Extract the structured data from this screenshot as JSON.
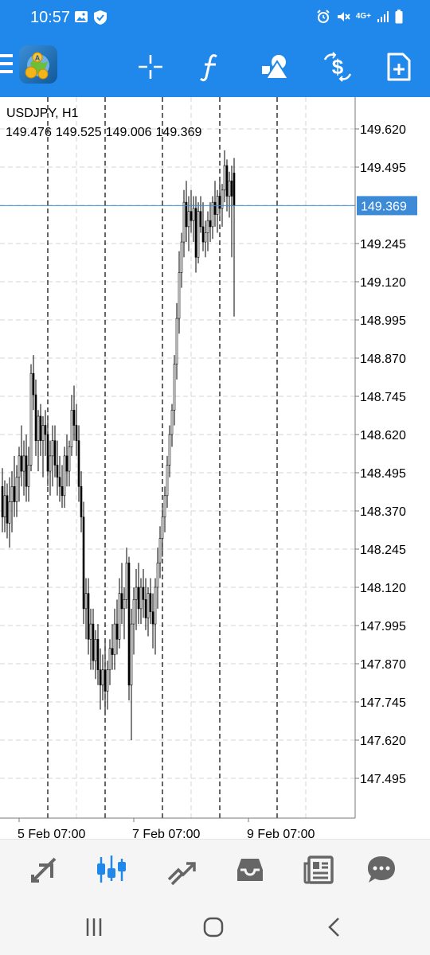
{
  "status_bar": {
    "time": "10:57",
    "icons_left": [
      "gallery-icon",
      "shield-check-icon"
    ],
    "icons_right": [
      "alarm-icon",
      "mute-icon",
      "4g-signal-icon",
      "signal-bars-icon",
      "battery-icon"
    ],
    "network_label": "4G+"
  },
  "toolbar": {
    "background": "#1f88ea",
    "icons": [
      "menu-icon",
      "app-logo-icon",
      "crosshair-icon",
      "indicators-icon",
      "objects-icon",
      "trade-icon",
      "new-order-icon"
    ]
  },
  "chart": {
    "symbol": "USDJPY, H1",
    "ohlc": [
      "149.476",
      "149.525",
      "149.006",
      "149.369"
    ],
    "current_price": "149.369",
    "current_price_value": 149.369,
    "price_labels": [
      "149.620",
      "149.495",
      "149.245",
      "149.120",
      "148.995",
      "148.870",
      "148.745",
      "148.620",
      "148.495",
      "148.370",
      "148.245",
      "148.120",
      "147.995",
      "147.870",
      "147.745",
      "147.620",
      "147.495"
    ],
    "price_levels": [
      149.62,
      149.495,
      149.37,
      149.245,
      149.12,
      148.995,
      148.87,
      148.745,
      148.62,
      148.495,
      148.37,
      148.245,
      148.12,
      147.995,
      147.87,
      147.745,
      147.62,
      147.495
    ],
    "time_labels": [
      {
        "text": "5 Feb 07:00",
        "bar": 7
      },
      {
        "text": "7 Feb 07:00",
        "bar": 55
      },
      {
        "text": "9 Feb 07:00",
        "bar": 103
      }
    ],
    "day_separator_bars": [
      19,
      43,
      67,
      91,
      115
    ],
    "colors": {
      "price_line": "#3d8bd6",
      "price_label_bg": "#3d8bd6",
      "grid": "#d6d6d6",
      "separator": "#000000",
      "bars": "#000000"
    }
  },
  "chart_data": {
    "type": "candlestick",
    "title": "USDJPY, H1",
    "y_range": [
      147.42,
      149.7
    ],
    "bars": [
      [
        148.45,
        148.51,
        148.3,
        148.35
      ],
      [
        148.35,
        148.47,
        148.3,
        148.42
      ],
      [
        148.42,
        148.46,
        148.28,
        148.33
      ],
      [
        148.33,
        148.48,
        148.25,
        148.4
      ],
      [
        148.4,
        148.5,
        148.3,
        148.45
      ],
      [
        148.45,
        148.55,
        148.35,
        148.4
      ],
      [
        148.4,
        148.52,
        148.35,
        148.48
      ],
      [
        148.48,
        148.58,
        148.4,
        148.55
      ],
      [
        148.55,
        148.65,
        148.45,
        148.5
      ],
      [
        148.5,
        148.6,
        148.42,
        148.55
      ],
      [
        148.55,
        148.62,
        148.4,
        148.45
      ],
      [
        148.45,
        148.58,
        148.4,
        148.52
      ],
      [
        148.52,
        148.85,
        148.5,
        148.82
      ],
      [
        148.82,
        148.88,
        148.7,
        148.75
      ],
      [
        148.75,
        148.8,
        148.55,
        148.6
      ],
      [
        148.6,
        148.7,
        148.5,
        148.68
      ],
      [
        148.68,
        148.72,
        148.55,
        148.6
      ],
      [
        148.6,
        148.68,
        148.48,
        148.65
      ],
      [
        148.65,
        148.7,
        148.55,
        148.62
      ],
      [
        148.62,
        148.68,
        148.45,
        148.5
      ],
      [
        148.5,
        148.6,
        148.42,
        148.55
      ],
      [
        148.55,
        148.65,
        148.45,
        148.6
      ],
      [
        148.6,
        148.65,
        148.48,
        148.52
      ],
      [
        148.52,
        148.6,
        148.42,
        148.48
      ],
      [
        148.48,
        148.55,
        148.4,
        148.45
      ],
      [
        148.45,
        148.52,
        148.38,
        148.42
      ],
      [
        148.42,
        148.58,
        148.38,
        148.55
      ],
      [
        148.55,
        148.62,
        148.45,
        148.5
      ],
      [
        148.5,
        148.6,
        148.45,
        148.58
      ],
      [
        148.58,
        148.75,
        148.55,
        148.7
      ],
      [
        148.7,
        148.78,
        148.6,
        148.65
      ],
      [
        148.65,
        148.72,
        148.55,
        148.6
      ],
      [
        148.6,
        148.65,
        148.4,
        148.45
      ],
      [
        148.45,
        148.5,
        148.3,
        148.35
      ],
      [
        148.35,
        148.4,
        148.0,
        148.05
      ],
      [
        148.05,
        148.15,
        147.95,
        148.1
      ],
      [
        148.1,
        148.15,
        147.9,
        147.95
      ],
      [
        147.95,
        148.05,
        147.85,
        148.0
      ],
      [
        148.0,
        148.05,
        147.85,
        147.88
      ],
      [
        147.88,
        147.98,
        147.82,
        147.95
      ],
      [
        147.95,
        148.0,
        147.8,
        147.85
      ],
      [
        147.85,
        147.92,
        147.72,
        147.8
      ],
      [
        147.8,
        147.9,
        147.75,
        147.85
      ],
      [
        147.85,
        147.95,
        147.7,
        147.78
      ],
      [
        147.78,
        147.88,
        147.72,
        147.85
      ],
      [
        147.85,
        147.95,
        147.8,
        147.92
      ],
      [
        147.92,
        148.0,
        147.85,
        147.9
      ],
      [
        147.9,
        148.05,
        147.85,
        148.0
      ],
      [
        148.0,
        148.08,
        147.9,
        147.95
      ],
      [
        147.95,
        148.15,
        147.92,
        148.1
      ],
      [
        148.1,
        148.2,
        148.0,
        148.05
      ],
      [
        148.05,
        148.12,
        147.95,
        148.08
      ],
      [
        148.08,
        148.25,
        148.05,
        148.2
      ],
      [
        148.2,
        148.22,
        147.75,
        147.8
      ],
      [
        147.8,
        148.05,
        147.62,
        148.0
      ],
      [
        148.0,
        148.12,
        147.9,
        148.08
      ],
      [
        148.08,
        148.18,
        147.98,
        148.12
      ],
      [
        148.12,
        148.2,
        148.0,
        148.05
      ],
      [
        148.05,
        148.15,
        148.0,
        148.12
      ],
      [
        148.12,
        148.18,
        148.02,
        148.08
      ],
      [
        148.08,
        148.15,
        147.98,
        148.02
      ],
      [
        148.02,
        148.12,
        147.96,
        148.1
      ],
      [
        148.1,
        148.15,
        148.0,
        148.04
      ],
      [
        148.04,
        148.1,
        147.92,
        148.0
      ],
      [
        148.0,
        148.15,
        147.9,
        148.12
      ],
      [
        148.12,
        148.25,
        148.05,
        148.2
      ],
      [
        148.2,
        148.32,
        148.15,
        148.28
      ],
      [
        148.28,
        148.38,
        148.22,
        148.35
      ],
      [
        148.35,
        148.45,
        148.3,
        148.42
      ],
      [
        148.42,
        148.55,
        148.38,
        148.52
      ],
      [
        148.52,
        148.65,
        148.48,
        148.62
      ],
      [
        148.62,
        148.72,
        148.58,
        148.7
      ],
      [
        148.7,
        148.88,
        148.65,
        148.85
      ],
      [
        148.85,
        149.05,
        148.8,
        149.0
      ],
      [
        149.0,
        149.22,
        148.95,
        149.15
      ],
      [
        149.15,
        149.28,
        149.1,
        149.25
      ],
      [
        149.25,
        149.42,
        149.2,
        149.38
      ],
      [
        149.38,
        149.45,
        149.25,
        149.3
      ],
      [
        149.3,
        149.4,
        149.22,
        149.35
      ],
      [
        149.35,
        149.42,
        149.28,
        149.32
      ],
      [
        149.32,
        149.4,
        149.25,
        149.36
      ],
      [
        149.36,
        149.4,
        149.15,
        149.2
      ],
      [
        149.2,
        149.38,
        149.18,
        149.35
      ],
      [
        149.35,
        149.4,
        149.28,
        149.3
      ],
      [
        149.3,
        149.38,
        149.22,
        149.25
      ],
      [
        149.25,
        149.32,
        149.2,
        149.28
      ],
      [
        149.28,
        149.35,
        149.22,
        149.32
      ],
      [
        149.32,
        149.38,
        149.25,
        149.3
      ],
      [
        149.3,
        149.4,
        149.26,
        149.38
      ],
      [
        149.38,
        149.45,
        149.3,
        149.34
      ],
      [
        149.34,
        149.42,
        149.28,
        149.4
      ],
      [
        149.4,
        149.46,
        149.32,
        149.36
      ],
      [
        149.36,
        149.44,
        149.3,
        149.42
      ],
      [
        149.42,
        149.55,
        149.38,
        149.5
      ],
      [
        149.5,
        149.52,
        149.35,
        149.4
      ],
      [
        149.4,
        149.48,
        149.33,
        149.45
      ],
      [
        149.45,
        149.5,
        149.2,
        149.4
      ],
      [
        149.476,
        149.525,
        149.006,
        149.369
      ]
    ]
  },
  "bottom_nav": {
    "items": [
      {
        "name": "quotes-icon",
        "active": false
      },
      {
        "name": "charts-icon",
        "active": true
      },
      {
        "name": "trade-icon",
        "active": false
      },
      {
        "name": "history-icon",
        "active": false
      },
      {
        "name": "news-icon",
        "active": false
      },
      {
        "name": "messages-icon",
        "active": false
      }
    ],
    "active_color": "#1f88ea",
    "inactive_color": "#666666"
  },
  "system_nav": [
    "recent-apps-icon",
    "home-icon",
    "back-icon"
  ]
}
